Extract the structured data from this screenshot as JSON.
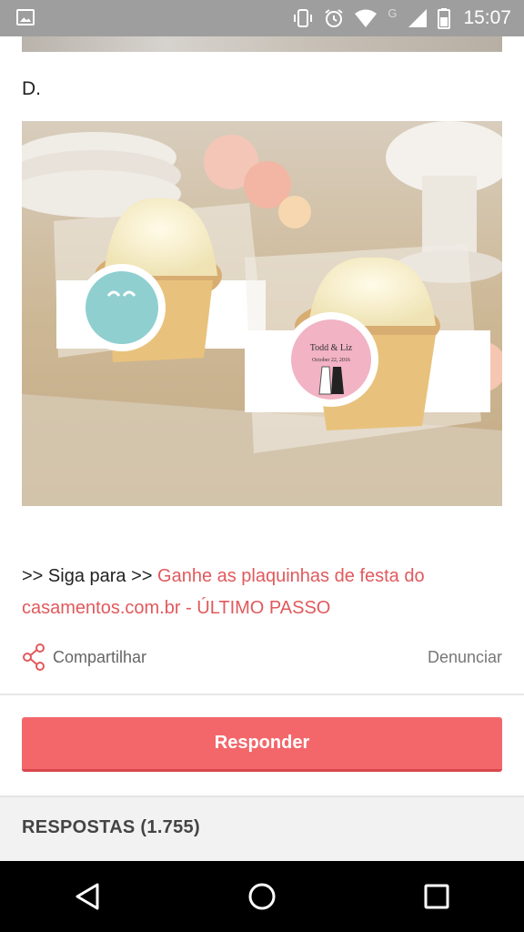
{
  "status_bar": {
    "time": "15:07",
    "network_label": "G",
    "icons": [
      "image-icon",
      "vibrate-icon",
      "alarm-icon",
      "wifi-icon",
      "signal-icon",
      "battery-icon"
    ]
  },
  "post": {
    "letter": "D.",
    "body_prefix": ">> Siga para >> ",
    "link_text": "Ganhe as plaquinhas de festa do casamentos.com.br - ÚLTIMO PASSO",
    "photo_label_pink": "Todd & Liz",
    "photo_label_pink_sub": "October 22, 2016"
  },
  "actions": {
    "share_label": "Compartilhar",
    "report_label": "Denunciar"
  },
  "reply_button": {
    "label": "Responder"
  },
  "answers": {
    "label": "RESPOSTAS (1.755)"
  },
  "colors": {
    "accent": "#f3676b",
    "link": "#e1595c",
    "status_bar": "#9e9e9e"
  }
}
